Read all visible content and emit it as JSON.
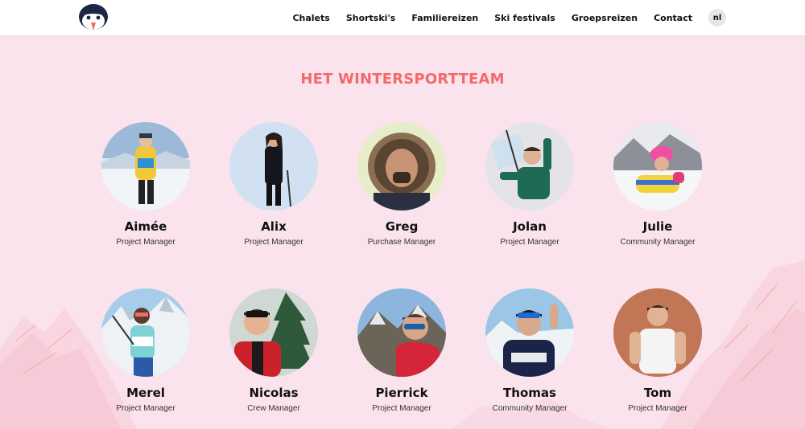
{
  "brand": {
    "logo_name": "penguin-logo"
  },
  "nav": {
    "items": [
      "Chalets",
      "Shortski's",
      "Familiereizen",
      "Ski festivals",
      "Groepsreizen",
      "Contact"
    ],
    "language": "nl"
  },
  "colors": {
    "background": "#fbe3ee",
    "heading": "#f26a6a",
    "header_bg": "#ffffff"
  },
  "heading": "HET WINTERSPORTTEAM",
  "team": [
    {
      "name": "Aimée",
      "role": "Project Manager"
    },
    {
      "name": "Alix",
      "role": "Project Manager"
    },
    {
      "name": "Greg",
      "role": "Purchase Manager"
    },
    {
      "name": "Jolan",
      "role": "Project Manager"
    },
    {
      "name": "Julie",
      "role": "Community Manager"
    },
    {
      "name": "Merel",
      "role": "Project Manager"
    },
    {
      "name": "Nicolas",
      "role": "Crew Manager"
    },
    {
      "name": "Pierrick",
      "role": "Project Manager"
    },
    {
      "name": "Thomas",
      "role": "Community Manager"
    },
    {
      "name": "Tom",
      "role": "Project Manager"
    }
  ]
}
